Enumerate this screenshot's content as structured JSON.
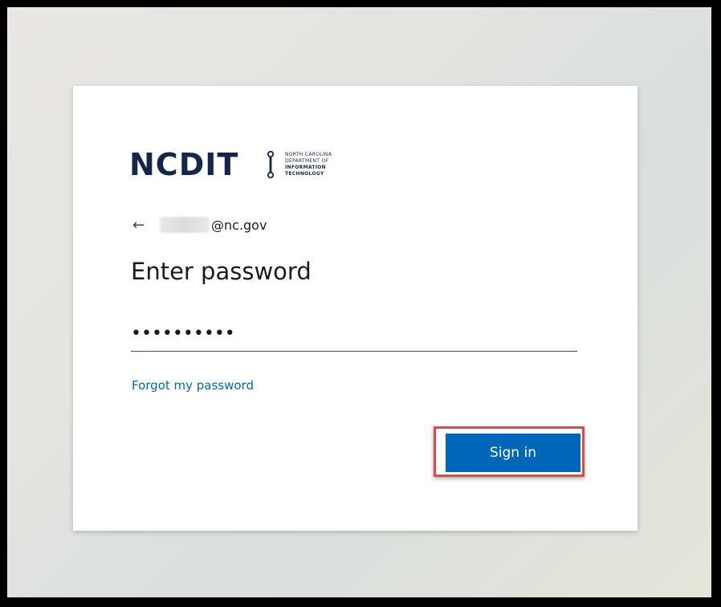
{
  "brand": {
    "name": "NCDIT",
    "subtitle_lines": [
      "NORTH CAROLINA",
      "DEPARTMENT OF",
      "INFORMATION",
      "TECHNOLOGY"
    ],
    "color": "#14274a"
  },
  "identity": {
    "back_icon": "arrow-left-icon",
    "domain": "@nc.gov"
  },
  "heading": "Enter password",
  "password_field": {
    "value": "••••••••••",
    "accent": "#0067b8"
  },
  "forgot_link": "Forgot my password",
  "signin_button": {
    "label": "Sign in",
    "color": "#0067b8",
    "highlight_color": "#e4474a"
  }
}
